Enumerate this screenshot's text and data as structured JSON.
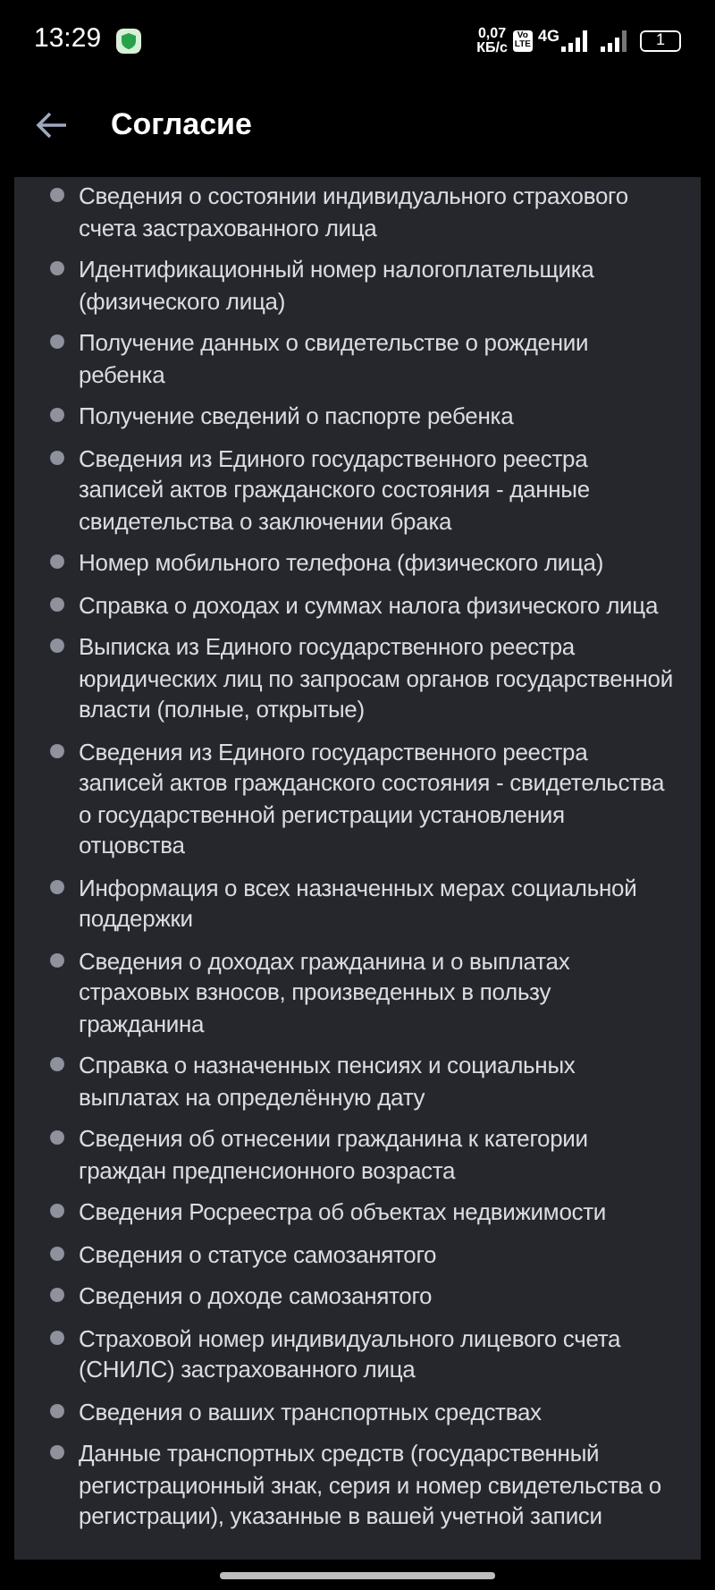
{
  "status_bar": {
    "time": "13:29",
    "speed_value": "0,07",
    "speed_unit": "КБ/с",
    "volte_top": "Vo",
    "volte_bottom": "LTE",
    "network": "4G",
    "battery": "1"
  },
  "header": {
    "title": "Согласие"
  },
  "items": [
    "Сведения о состоянии индивидуального страхового счета застрахованного лица",
    "Идентификационный номер налогоплательщика (физического лица)",
    "Получение данных о свидетельстве о рождении ребенка",
    "Получение сведений о паспорте ребенка",
    "Сведения из Единого государственного реестра записей актов гражданского состояния - данные свидетельства о заключении брака",
    "Номер мобильного телефона (физического лица)",
    "Справка о доходах и суммах налога физического лица",
    "Выписка из Единого государственного реестра юридических лиц по запросам органов государственной власти (полные, открытые)",
    "Сведения из Единого государственного реестра записей актов гражданского состояния - свидетельства о государственной регистрации установления отцовства",
    "Информация о всех назначенных мерах социальной поддержки",
    "Сведения о доходах гражданина и о выплатах страховых взносов, произведенных в пользу гражданина",
    "Справка о назначенных пенсиях и социальных выплатах на определённую дату",
    "Сведения об отнесении гражданина к категории граждан предпенсионного возраста",
    "Сведения Росреестра об объектах недвижимости",
    "Сведения о статусе самозанятого",
    "Сведения о доходе самозанятого",
    "Страховой номер индивидуального лицевого счета (СНИЛС) застрахованного лица",
    "Сведения о ваших транспортных средствах",
    "Данные транспортных средств (государственный регистрационный знак, серия и номер свидетельства о регистрации), указанные в вашей учетной записи"
  ]
}
